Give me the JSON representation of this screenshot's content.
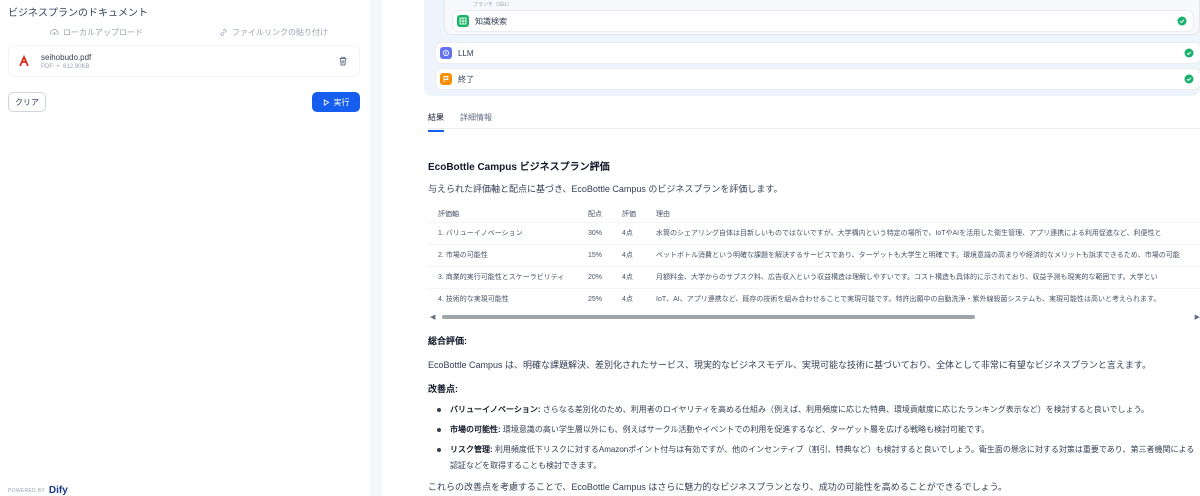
{
  "left": {
    "section_title": "ビジネスプランのドキュメント",
    "upload_tabs": [
      "ローカルアップロード",
      "ファイルリンクの貼り付け"
    ],
    "file": {
      "name": "seihobudo.pdf",
      "type": "PDF",
      "sep": "•",
      "size": "612.90KB"
    },
    "clear_label": "クリア",
    "run_label": "実行",
    "powered_by": "POWERED BY",
    "brand": "Dify"
  },
  "workflow": {
    "group_caption": "ブランチ（SEL）",
    "nodes": [
      {
        "label": "知識検索",
        "icon": "knowledge-icon",
        "color": "#16b364"
      },
      {
        "label": "LLM",
        "icon": "llm-icon",
        "color": "#6172f3"
      },
      {
        "label": "終了",
        "icon": "end-icon",
        "color": "#f79009"
      }
    ],
    "status_color": "#17b26a"
  },
  "tabs": [
    "結果",
    "詳細情報"
  ],
  "result": {
    "title": "EcoBottle Campus ビジネスプラン評価",
    "intro": "与えられた評価軸と配点に基づき、EcoBottle Campus のビジネスプランを評価します。",
    "table": {
      "headers": [
        "評価軸",
        "配点",
        "評価",
        "理由"
      ],
      "rows": [
        [
          "1. バリューイノベーション",
          "30%",
          "4点",
          "水筒のシェアリング自体は目新しいものではないですが、大学構内という特定の場所で、IoTやAIを活用した衛生管理、アプリ連携による利用促進など、利便性と"
        ],
        [
          "2. 市場の可能性",
          "15%",
          "4点",
          "ペットボトル消費という明確な課題を解決するサービスであり、ターゲットも大学生と明確です。環境意識の高まりや経済的なメリットも訴求できるため、市場の可能"
        ],
        [
          "3. 商業的実行可能性とスケーラビリティ",
          "20%",
          "4点",
          "月額料金、大学からのサブスク料、広告収入という収益構造は理解しやすいです。コスト構造も具体的に示されており、収益予測も現実的な範囲です。大学とい"
        ],
        [
          "4. 技術的な実現可能性",
          "25%",
          "4点",
          "IoT、AI、アプリ連携など、既存の技術を組み合わせることで実現可能です。特許出願中の自動洗浄・紫外線殺菌システムも、実現可能性は高いと考えられます。"
        ]
      ]
    },
    "overall_heading": "総合評価:",
    "overall_text": "EcoBottle Campus は、明確な課題解決、差別化されたサービス、現実的なビジネスモデル、実現可能な技術に基づいており、全体として非常に有望なビジネスプランと言えます。",
    "improve_heading": "改善点:",
    "improvements": [
      {
        "bold": "バリューイノベーション:",
        "text": " さらなる差別化のため、利用者のロイヤリティを高める仕組み（例えば、利用頻度に応じた特典、環境貢献度に応じたランキング表示など）を検討すると良いでしょう。"
      },
      {
        "bold": "市場の可能性:",
        "text": " 環境意識の高い学生層以外にも、例えばサークル活動やイベントでの利用を促進するなど、ターゲット層を広げる戦略も検討可能です。"
      },
      {
        "bold": "リスク管理:",
        "text": " 利用頻度低下リスクに対するAmazonポイント付与は有効ですが、他のインセンティブ（割引、特典など）も検討すると良いでしょう。衛生面の懸念に対する対策は重要であり、第三者機関による認証などを取得することも検討できます。"
      }
    ],
    "closing": "これらの改善点を考慮することで、EcoBottle Campus はさらに魅力的なビジネスプランとなり、成功の可能性を高めることができるでしょう。"
  }
}
